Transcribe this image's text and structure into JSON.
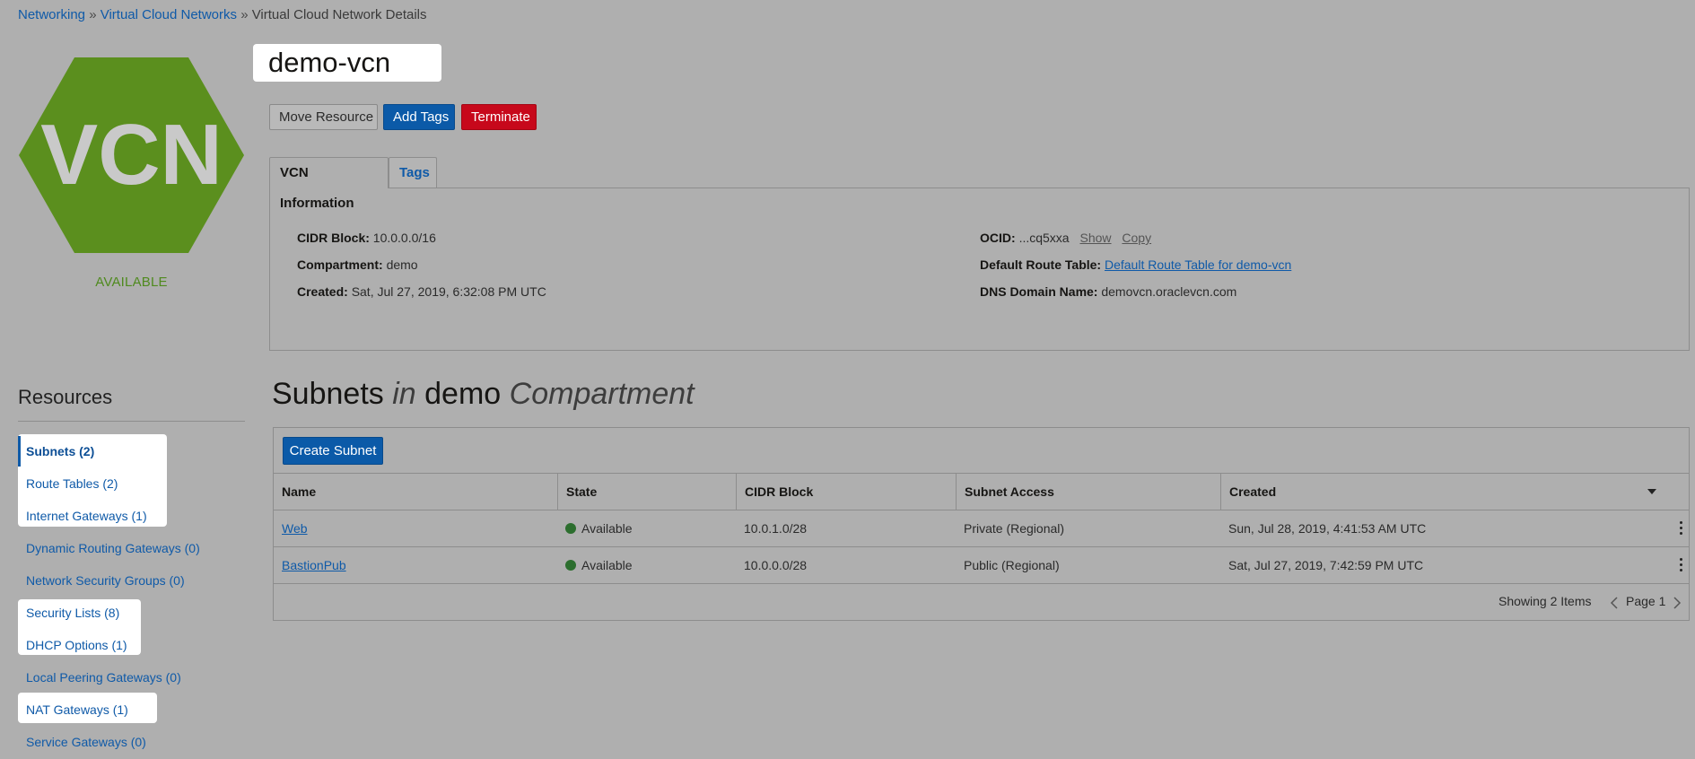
{
  "breadcrumb": {
    "items": [
      "Networking",
      "Virtual Cloud Networks",
      "Virtual Cloud Network Details"
    ],
    "separator": "»"
  },
  "resource": {
    "icon_text": "VCN",
    "icon_color": "#5b8f1e",
    "status": "AVAILABLE",
    "name": "demo-vcn"
  },
  "actions": {
    "move": "Move Resource",
    "add_tags": "Add Tags",
    "terminate": "Terminate"
  },
  "tabs": {
    "info": "VCN Information",
    "tags": "Tags"
  },
  "info": {
    "cidr_label": "CIDR Block:",
    "cidr_value": "10.0.0.0/16",
    "compartment_label": "Compartment:",
    "compartment_value": "demo",
    "created_label": "Created:",
    "created_value": "Sat, Jul 27, 2019, 6:32:08 PM UTC",
    "ocid_label": "OCID:",
    "ocid_value": "...cq5xxa",
    "ocid_show": "Show",
    "ocid_copy": "Copy",
    "route_label": "Default Route Table:",
    "route_value": "Default Route Table for demo-vcn",
    "dns_label": "DNS Domain Name:",
    "dns_value": "demovcn.oraclevcn.com"
  },
  "resources": {
    "title": "Resources",
    "items": [
      "Subnets (2)",
      "Route Tables (2)",
      "Internet Gateways (1)",
      "Dynamic Routing Gateways (0)",
      "Network Security Groups (0)",
      "Security Lists (8)",
      "DHCP Options (1)",
      "Local Peering Gateways (0)",
      "NAT Gateways (1)",
      "Service Gateways (0)"
    ]
  },
  "subnets": {
    "heading_a": "Subnets",
    "heading_in": "in",
    "heading_b": "demo",
    "heading_c": "Compartment",
    "create_button": "Create Subnet",
    "columns": [
      "Name",
      "State",
      "CIDR Block",
      "Subnet Access",
      "Created"
    ],
    "rows": [
      {
        "name": "Web",
        "state": "Available",
        "cidr": "10.0.1.0/28",
        "access": "Private (Regional)",
        "created": "Sun, Jul 28, 2019, 4:41:53 AM UTC"
      },
      {
        "name": "BastionPub",
        "state": "Available",
        "cidr": "10.0.0.0/28",
        "access": "Public (Regional)",
        "created": "Sat, Jul 27, 2019, 7:42:59 PM UTC"
      }
    ],
    "showing": "Showing 2 Items",
    "page": "Page 1"
  }
}
